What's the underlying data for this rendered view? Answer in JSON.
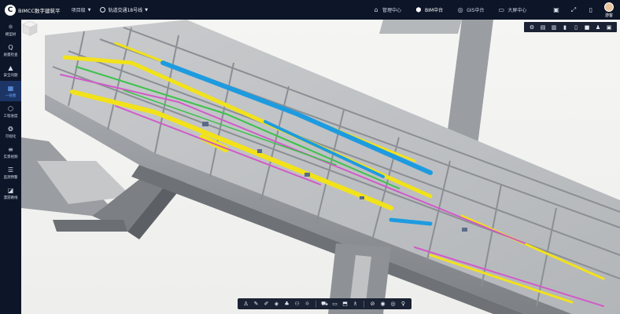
{
  "header": {
    "logo_mark": "C",
    "logo_text": "BIMCC数字建筑平",
    "project_label": "项目级",
    "line_label": "轨道交通18号线",
    "nav": [
      {
        "label": "管理中心",
        "icon": "home-icon",
        "active": false
      },
      {
        "label": "BIM中台",
        "icon": "cube-icon",
        "active": true
      },
      {
        "label": "GIS中台",
        "icon": "globe-icon",
        "active": false
      },
      {
        "label": "大屏中心",
        "icon": "monitor-icon",
        "active": false
      }
    ],
    "user_name": "游客"
  },
  "sidebar": {
    "items": [
      {
        "label": "模型树",
        "glyph": "⚛"
      },
      {
        "label": "质量检查",
        "glyph": "Q"
      },
      {
        "label": "安全问题",
        "glyph": "▲"
      },
      {
        "label": "一张图",
        "glyph": "▦"
      },
      {
        "label": "工程进度",
        "glyph": "⬡"
      },
      {
        "label": "可视化",
        "glyph": "❂"
      },
      {
        "label": "实景视频",
        "glyph": "≡"
      },
      {
        "label": "监测预警",
        "glyph": "☰"
      },
      {
        "label": "漫游路线",
        "glyph": "◪"
      }
    ],
    "active_index": 3
  },
  "right_toolbar": {
    "tools": [
      "⚙",
      "▤",
      "▥",
      "▮",
      "▯",
      "■",
      "♟",
      "▣"
    ]
  },
  "bottom_toolbar": {
    "group1": [
      "♙",
      "✎",
      "✐",
      "◈",
      "♣",
      "⚇",
      "☼"
    ],
    "group2": [
      "⛟",
      "▭",
      "⬒",
      "♗"
    ],
    "group3": [
      "⊘",
      "◉",
      "◎",
      "♀"
    ]
  },
  "colors": {
    "chrome": "#0d1628",
    "accent": "#6fa8ff",
    "pipe_yellow": "#f2e21a",
    "pipe_blue": "#1e9be0",
    "pipe_magenta": "#d05ac8",
    "pipe_green": "#3cc24a"
  }
}
